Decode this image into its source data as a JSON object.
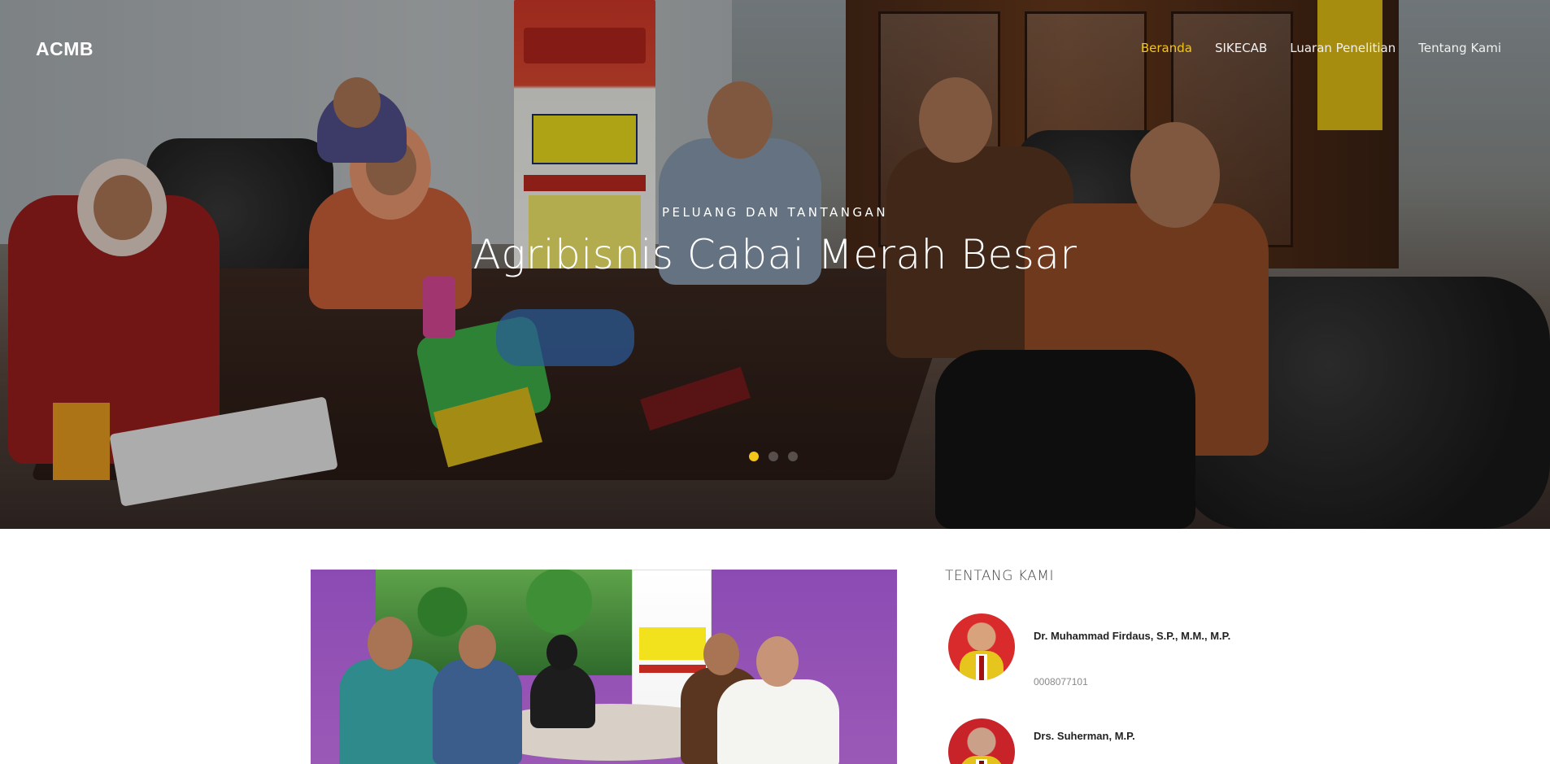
{
  "header": {
    "logo": "ACMB",
    "nav": [
      {
        "label": "Beranda",
        "active": true
      },
      {
        "label": "SIKECAB",
        "active": false
      },
      {
        "label": "Luaran Penelitian",
        "active": false
      },
      {
        "label": "Tentang Kami",
        "active": false
      }
    ]
  },
  "hero": {
    "subtitle": "PELUANG DAN TANTANGAN",
    "title": "Agribisnis Cabai Merah Besar",
    "slide_count": 3,
    "active_slide": 1
  },
  "about": {
    "title": "TENTANG KAMI",
    "members": [
      {
        "name": "Dr. Muhammad Firdaus, S.P., M.M., M.P.",
        "id": "0008077101"
      },
      {
        "name": "Drs. Suherman, M.P.",
        "id": ""
      }
    ]
  },
  "colors": {
    "accent": "#f3c61a",
    "nav_text": "#f1f1f1"
  }
}
